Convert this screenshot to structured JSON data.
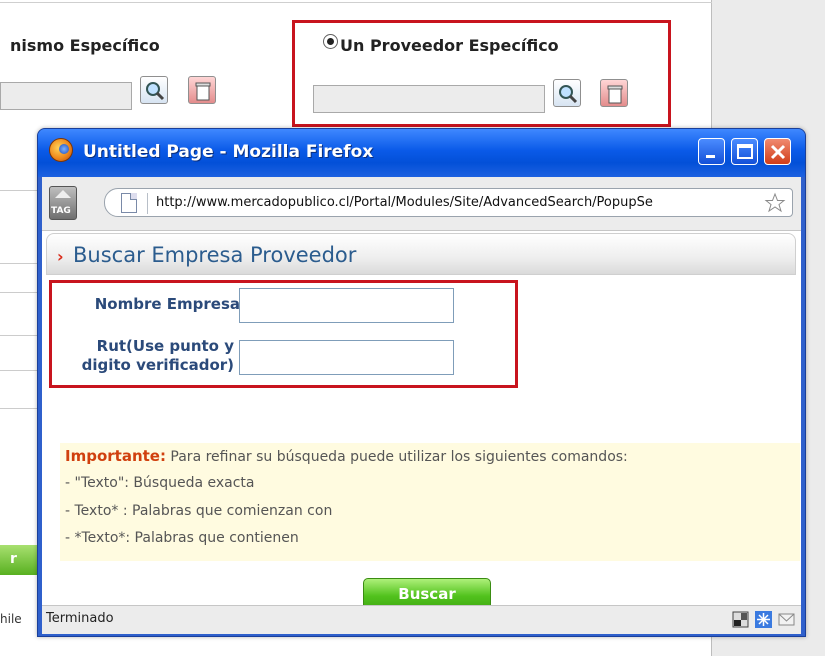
{
  "background": {
    "label_left": "nismo Específico",
    "label_right": "Un Proveedor Específico",
    "green_button": "r",
    "footer_fragment": "hile"
  },
  "window": {
    "title": "Untitled Page - Mozilla Firefox",
    "url": "http://www.mercadopublico.cl/Portal/Modules/Site/AdvancedSearch/PopupSe",
    "tag_label": "TAG",
    "status": "Terminado"
  },
  "panel": {
    "title": "Buscar Empresa Proveedor",
    "field_name_label": "Nombre Empresa",
    "field_rut_label_1": "Rut(Use punto y",
    "field_rut_label_2": "digito verificador)",
    "field_name_value": "",
    "field_rut_value": ""
  },
  "note": {
    "heading": "Importante:",
    "intro": " Para refinar su búsqueda puede utilizar los siguientes comandos:",
    "line1": "- \"Texto\": Búsqueda exacta",
    "line2": "- Texto* : Palabras que comienzan con",
    "line3": "- *Texto*: Palabras que contienen"
  },
  "button": {
    "label": "Buscar"
  },
  "colors": {
    "highlight": "#c8141e",
    "titlebar": "#0a5ae8",
    "panel_title": "#2b5c8e",
    "button": "#52c21d"
  }
}
